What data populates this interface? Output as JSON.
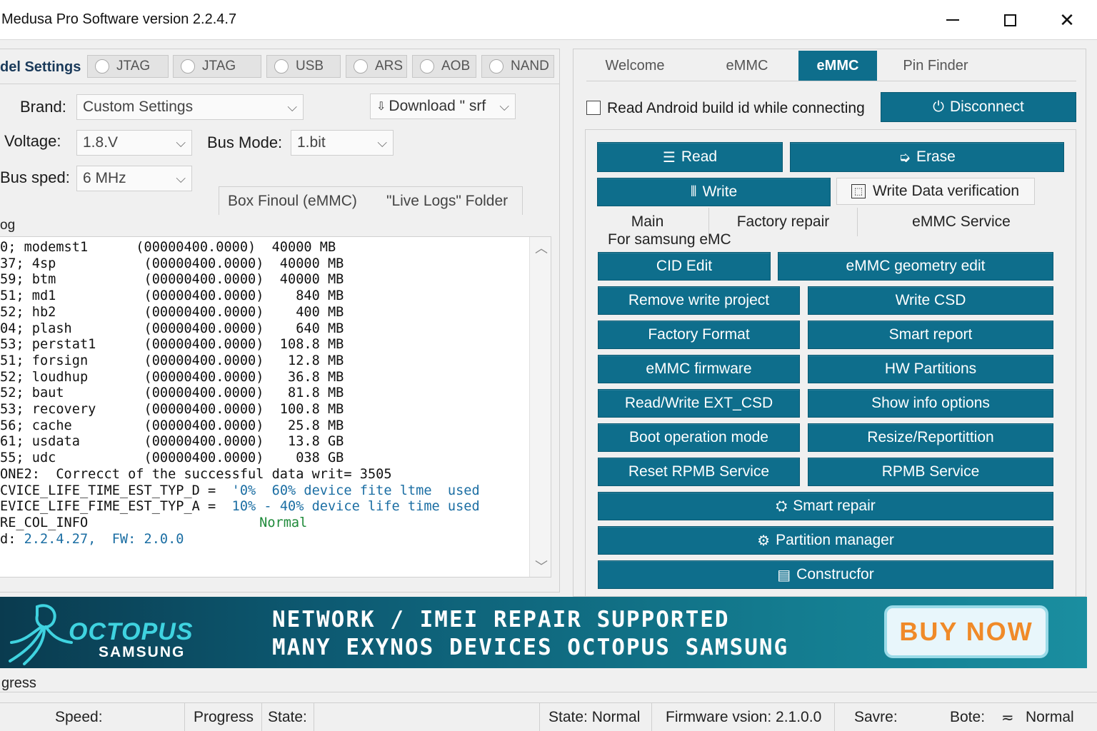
{
  "window": {
    "title": "Medusa Pro Software version 2.2.4.7",
    "close_glyph": "✕"
  },
  "left": {
    "section_title": "del Settings",
    "tabs": [
      "JTAG",
      "JTAG",
      "USB",
      "ARS",
      "AOB",
      "NAND"
    ],
    "brand_label": "Brand:",
    "brand_value": "Custom Settings",
    "download_value": "Download \" srf",
    "voltage_label": "Voltage:",
    "voltage_value": "1.8.V",
    "busmode_label": "Bus Mode:",
    "busmode_value": "1.bit",
    "busspeed_label": "Bus sped:",
    "busspeed_value": "6 MHz",
    "subtabs": [
      "Box Finoul (eMMC)",
      "\"Live Logs\" Folder"
    ],
    "log_label": "og",
    "log_lines": [
      "0; modemst1      (00000400.0000)  40000 MB",
      "37; 4sp           (00000400.0000)  40000 MB",
      "59; btm           (00000400.0000)  40000 MB",
      "51; md1           (00000400.0000)    840 MB",
      "52; hb2           (00000400.0000)    400 MB",
      "04; plash         (00000400.0000)    640 MB",
      "53; perstat1      (00000400.0000)  108.8 MB",
      "51; forsign       (00000400.0000)   12.8 MB",
      "52; loudhup       (00000400.0000)   36.8 MB",
      "52; baut          (00000400.0000)   81.8 MB",
      "53; recovery      (00000400.0000)  100.8 MB",
      "56; cache         (00000400.0000)   25.8 MB",
      "61; usdata        (00000400.0000)   13.8 GB",
      "55; udc           (00000400.0000)    038 GB",
      "ONE2:  Correcct of the successful data writ= 3505"
    ],
    "life_a_key": "CVICE_LIFE_TIME_EST_TYP_D = ",
    "life_a_val": " '0%  60% device fite ltme  used",
    "life_b_key": "EVICE_LIFE_FIME_EST_TYP_A = ",
    "life_b_val": " 10% - 40% device life time used",
    "re_col": "RE_COL_INFO",
    "normal": "Normal",
    "ver_key": "d: ",
    "ver_val": "2.2.4.27,  FW: 2.0.0"
  },
  "right": {
    "tabs": [
      "Welcome",
      "eMMC",
      "eMMC",
      "Pin Finder"
    ],
    "checkbox_label": "Read Android build id while connecting",
    "disconnect": "Disconnect",
    "read": "Read",
    "erase": "Erase",
    "write": "Write",
    "write_verify": "Write Data verification",
    "sections": [
      "Main",
      "Factory repair",
      "eMMC Service"
    ],
    "samsung_label": "For samsung eMC",
    "buttons": {
      "cid_edit": "CID Edit",
      "geometry_edit": "eMMC geometry edit",
      "remove_write_project": "Remove write project",
      "write_csd": "Write CSD",
      "factory_format": "Factory Format",
      "smart_report": "Smart report",
      "emmc_firmware": "eMMC firmware",
      "hw_partitions": "HW Partitions",
      "rw_ext_csd": "Read/Write EXT_CSD",
      "show_info_options": "Show info options",
      "boot_operation_mode": "Boot operation mode",
      "resize_repartition": "Resize/Reportittion",
      "reset_rpmb": "Reset RPMB Service",
      "rpmb_service": "RPMB Service",
      "smart_repair": "Smart repair",
      "partition_manager": "Partition manager",
      "constructor": "Construcfor"
    }
  },
  "banner": {
    "logo_word": "OCTOPUS",
    "logo_sub": "SAMSUNG",
    "line1": "NETWORK / IMEI REPAIR SUPPORTED",
    "line2": "MANY EXYNOS DEVICES OCTOPUS SAMSUNG",
    "cta": "BUY NOW"
  },
  "progress": {
    "label": "gress"
  },
  "status": {
    "speed": "Speed:",
    "progress": "Progress",
    "state": "State:",
    "state_normal": "State: Normal",
    "firmware": "Firmware vsion: 2.1.0.0",
    "save": "Savre:",
    "bote": "Bote:",
    "mode": "Normal"
  },
  "colors": {
    "accent": "#0e6e8c",
    "log_blue": "#1b6ea3",
    "log_green": "#1f8a3a",
    "cta_text": "#f08a28"
  }
}
